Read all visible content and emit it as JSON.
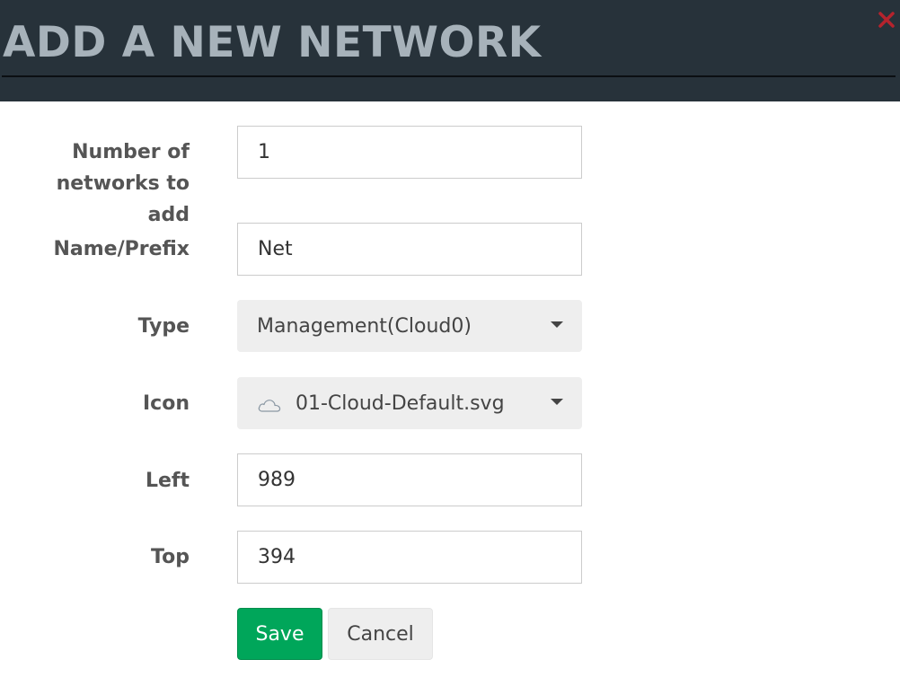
{
  "dialog": {
    "title": "ADD A NEW NETWORK",
    "close_glyph": "×",
    "accent_color": "#27323a",
    "close_color": "#b5232d"
  },
  "form": {
    "count": {
      "label_line1": "Number of",
      "label_line2": "networks to add",
      "value": "1"
    },
    "name": {
      "label": "Name/Prefix",
      "value": "Net"
    },
    "type": {
      "label": "Type",
      "value": "Management(Cloud0)"
    },
    "icon": {
      "label": "Icon",
      "value": "01-Cloud-Default.svg",
      "icon": "cloud-icon"
    },
    "left": {
      "label": "Left",
      "value": "989"
    },
    "top": {
      "label": "Top",
      "value": "394"
    }
  },
  "actions": {
    "save_label": "Save",
    "cancel_label": "Cancel",
    "save_color": "#00a65a"
  }
}
